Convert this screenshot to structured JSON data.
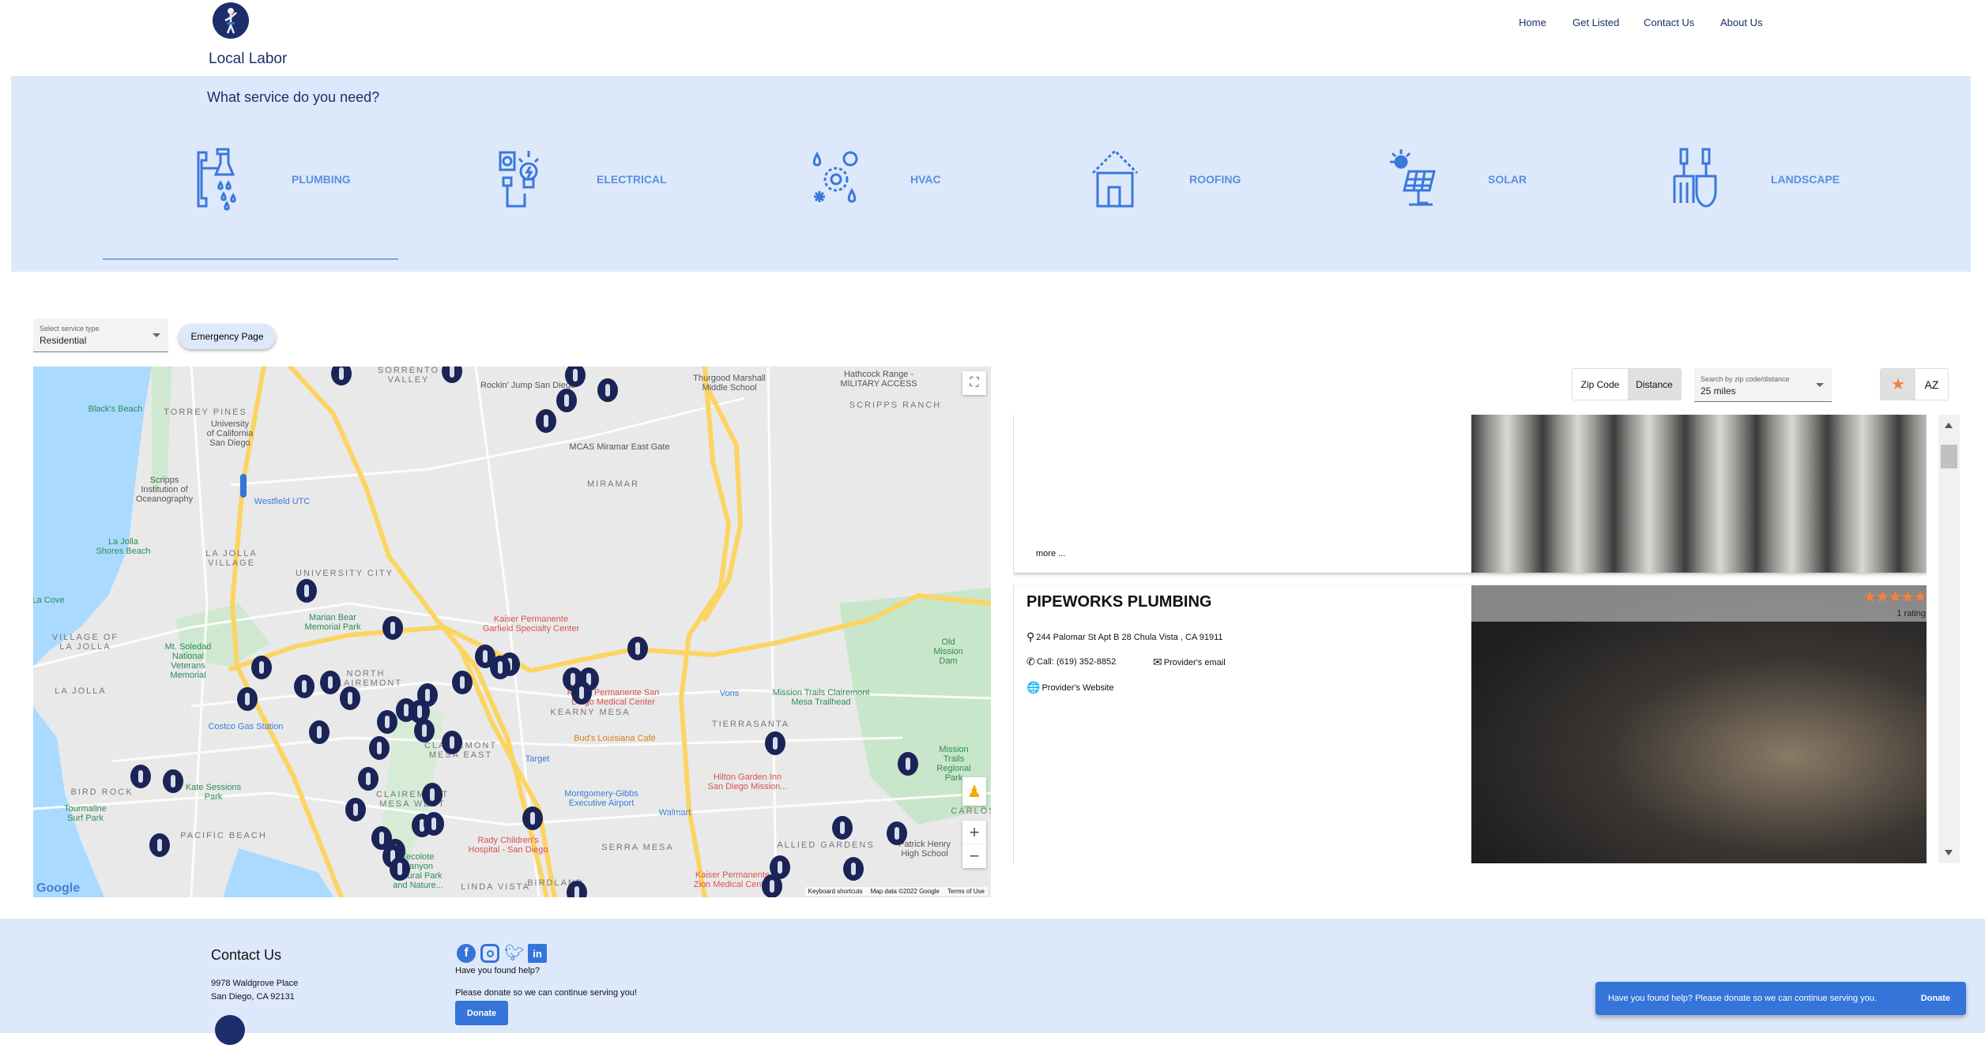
{
  "header": {
    "brand": "Local Labor",
    "nav": [
      "Home",
      "Get Listed",
      "Contact Us",
      "About Us"
    ]
  },
  "services": {
    "question": "What service do you need?",
    "items": [
      {
        "label": "PLUMBING",
        "icon": "plumbing-icon"
      },
      {
        "label": "ELECTRICAL",
        "icon": "electrical-icon"
      },
      {
        "label": "HVAC",
        "icon": "hvac-icon"
      },
      {
        "label": "ROOFING",
        "icon": "roofing-icon"
      },
      {
        "label": "SOLAR",
        "icon": "solar-icon"
      },
      {
        "label": "LANDSCAPE",
        "icon": "landscape-icon"
      }
    ],
    "selected": "PLUMBING"
  },
  "filters": {
    "service_type_label": "Select service type",
    "service_type_value": "Residential",
    "emergency": "Emergency Page",
    "search_mode": [
      "Zip Code",
      "Distance"
    ],
    "search_mode_selected": "Distance",
    "distance_label": "Search by zip code/distance",
    "distance_value": "25 miles",
    "sort_az": "AZ"
  },
  "map": {
    "labels": [
      "Black's Beach",
      "TORREY PINES",
      "University\nof California\nSan Diego",
      "Scripps\nInstitution of\nOceanography",
      "Westfield UTC",
      "La Jolla\nShores Beach",
      "LA JOLLA\nVILLAGE",
      "UNIVERSITY CITY",
      "MIRAMAR",
      "MCAS Miramar East Gate",
      "Thurgood Marshall\nMiddle School",
      "Hathcock Range -\nMILITARY ACCESS",
      "SCRIPPS RANCH",
      "Rockin' Jump San Diego",
      "SORRENTO\nVALLEY",
      "Marian Bear\nMemorial Park",
      "Kaiser Permanente\nGarfield Specialty Center",
      "Mt. Soledad\nNational\nVeterans\nMemorial",
      "VILLAGE OF\nLA JOLLA",
      "LA JOLLA",
      "La Cove",
      "NORTH\nCLAIREMONT",
      "Costco Gas Station",
      "Kaiser Permanente San\nDiego Medical Center",
      "KEARNY MESA",
      "Vons",
      "Mission Trails Clairemont\nMesa Trailhead",
      "Old Mission Dam",
      "TIERRASANTA",
      "Bud's Louisiana Café",
      "Target",
      "CLAIREMONT\nMESA EAST",
      "Montgomery-Gibbs\nExecutive Airport",
      "Hilton Garden Inn\nSan Diego Mission...",
      "Walmart",
      "Kate Sessions\nPark",
      "BIRD ROCK",
      "Tourmaline\nSurf Park",
      "PACIFIC BEACH",
      "Rady Children's\nHospital - San Diego",
      "SERRA MESA",
      "ALLIED GARDENS",
      "Patrick Henry\nHigh School",
      "LINDA VISTA",
      "BIRDLAND",
      "Kaiser Permanente\nZion Medical Center",
      "SAN CARLOS",
      "Tecolote\nCanyon\nNatural Park\nand Nature...",
      "Mission Trails\nRegional Park",
      "CLAIREMONT\nMESA WEST"
    ],
    "google": "Google",
    "shortcuts": "Keyboard shortcuts",
    "attribution": "Map data ©2022 Google",
    "terms": "Terms of Use"
  },
  "listings": [
    {
      "more": "more ..."
    },
    {
      "name": "PIPEWORKS PLUMBING",
      "rating": 5,
      "rating_count": "1 rating",
      "address": "244 Palomar St Apt B 28 Chula Vista , CA 91911",
      "phone": "Call: (619) 352-8852",
      "email": "Provider's email",
      "website": "Provider's Website"
    }
  ],
  "footer": {
    "contact_title": "Contact Us",
    "address1": "9978 Waldgrove Place",
    "address2": "San Diego, CA 92131",
    "help": "Have you found help?",
    "donate_text": "Please donate so we can continue serving you!",
    "donate": "Donate",
    "social": [
      "facebook-icon",
      "instagram-icon",
      "twitter-icon",
      "linkedin-icon"
    ]
  },
  "snackbar": {
    "text": "Have you found help? Please donate so we can continue serving you.",
    "action": "Donate"
  },
  "colors": {
    "band": "#dde9fb",
    "accent": "#3574d9",
    "navy": "#1c2e6b",
    "star": "#f5813a"
  }
}
